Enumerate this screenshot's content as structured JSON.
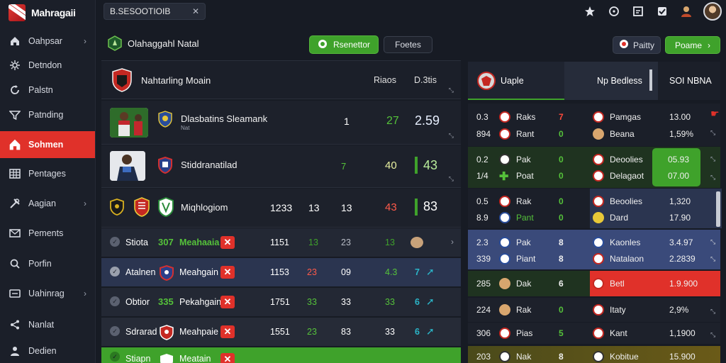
{
  "app": {
    "name": "Mahragaii"
  },
  "search": {
    "value": "B.SESOOTIOIB"
  },
  "sidebar": {
    "items": [
      {
        "label": "Oahpsar",
        "icon": "home-icon",
        "chevron": true
      },
      {
        "label": "Detndon",
        "icon": "network-icon",
        "chevron": false
      },
      {
        "label": "Palstn",
        "icon": "refresh-icon",
        "chevron": false
      },
      {
        "label": "Patnding",
        "icon": "filter-icon",
        "chevron": false
      },
      {
        "label": "Sohmen",
        "icon": "home-icon",
        "chevron": false,
        "active": true
      },
      {
        "label": "Pentages",
        "icon": "grid-icon",
        "chevron": false
      },
      {
        "label": "Aagian",
        "icon": "tools-icon",
        "chevron": true
      },
      {
        "label": "Pements",
        "icon": "envelope-icon",
        "chevron": false
      },
      {
        "label": "Porfin",
        "icon": "search-icon",
        "chevron": false
      },
      {
        "label": "Uahinrag",
        "icon": "folder-icon",
        "chevron": true
      },
      {
        "label": "Nanlat",
        "icon": "share-icon",
        "chevron": false
      },
      {
        "label": "Dedien",
        "icon": "user-icon",
        "chevron": false
      }
    ]
  },
  "main": {
    "title": "Olahaggahl Natal",
    "btn_primary": "Rsenettor",
    "btn_secondary": "Foetes",
    "header": {
      "title": "Nahtarling Moain",
      "col1": "Riaos",
      "col2": "D.3tis"
    },
    "featured": [
      {
        "name": "Dlasbatins Sleamank",
        "sub": "Nat",
        "v1": "1",
        "v2": "27",
        "v3": "2.59"
      },
      {
        "name": "Stiddranatilad",
        "v1": "7",
        "v2": "40",
        "v3": "43"
      },
      {
        "name": "Miqhlogiom",
        "v1": "1233",
        "v2": "13",
        "v3": "13",
        "v4": "43",
        "v5": "83"
      }
    ],
    "matches": [
      {
        "team": "Stiota",
        "score": "307",
        "name": "Meahaaia",
        "c1": "1151",
        "c2": "13",
        "c3": "23",
        "c4": "13"
      },
      {
        "team": "Atalnen",
        "score": "",
        "name": "Meahgain",
        "c1": "1153",
        "c2": "23",
        "c3": "09",
        "c4": "4.3",
        "c5": "7"
      },
      {
        "team": "Obtior",
        "score": "335",
        "name": "Pekahgain",
        "c1": "1751",
        "c2": "33",
        "c3": "33",
        "c4": "33",
        "c5": "6"
      },
      {
        "team": "Sdrarad",
        "score": "",
        "name": "Meahpaie",
        "c1": "1551",
        "c2": "23",
        "c3": "83",
        "c4": "33",
        "c5": "6"
      },
      {
        "team": "Stiapn",
        "score": "",
        "name": "Meatain",
        "c1": "",
        "c2": "",
        "c3": "",
        "c4": "",
        "c5": ""
      }
    ]
  },
  "right": {
    "header": {
      "tab": "Uaple",
      "col": "Np Bedless",
      "col2": "SOI NBNA"
    },
    "rows": [
      {
        "a1": "0.3",
        "a2": "894",
        "t1": "Raks",
        "t2": "Rant",
        "s1": "7",
        "s2": "0",
        "n1": "Pamgas",
        "n2": "Beana",
        "v1": "13.00",
        "v2": "1,59%"
      },
      {
        "a1": "0.2",
        "a2": "1/4",
        "t1": "Pak",
        "t2": "Poat",
        "s1": "0",
        "s2": "0",
        "n1": "Deoolies",
        "n2": "Delagaot",
        "v1": "05.93",
        "v2": "07.00"
      },
      {
        "a1": "0.5",
        "a2": "8.9",
        "t1": "Rak",
        "t2": "Pant",
        "s1": "0",
        "s2": "0",
        "n1": "Beoolies",
        "n2": "Dard",
        "v1": "1,320",
        "v2": "17.90"
      },
      {
        "a1": "2.3",
        "a2": "339",
        "t1": "Pak",
        "t2": "Piant",
        "s1": "8",
        "s2": "8",
        "n1": "Kaonles",
        "n2": "Natalaon",
        "v1": "3.4.97",
        "v2": "2.2839"
      },
      {
        "a1": "285",
        "t1": "Dak",
        "s1": "6",
        "n1": "Betl",
        "v1": "1.9.900"
      },
      {
        "a1": "224",
        "t1": "Rak",
        "s1": "0",
        "n1": "Itaty",
        "v1": "2,9%"
      },
      {
        "a1": "306",
        "t1": "Pias",
        "s1": "5",
        "n1": "Kant",
        "v1": "1,1900"
      },
      {
        "a1": "203",
        "t1": "Nak",
        "s1": "8",
        "n1": "Kobitue",
        "v1": "15.900"
      }
    ]
  },
  "topbar": {
    "btn_profile": "Paitty",
    "btn_action": "Poame"
  },
  "colors": {
    "accent_red": "#e0312a",
    "accent_green": "#3fa22b",
    "bg": "#171b24"
  }
}
